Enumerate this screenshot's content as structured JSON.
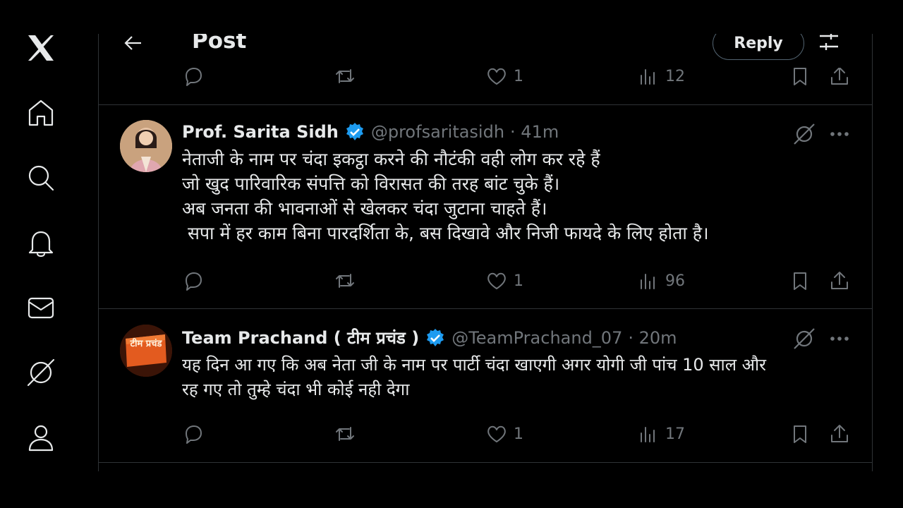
{
  "page": {
    "title": "Post",
    "reply_button": "Reply"
  },
  "sidebar": {
    "items": [
      {
        "name": "x-logo-icon"
      },
      {
        "name": "home-icon"
      },
      {
        "name": "search-icon"
      },
      {
        "name": "bell-icon"
      },
      {
        "name": "mail-icon"
      },
      {
        "name": "grok-icon"
      },
      {
        "name": "profile-icon"
      }
    ]
  },
  "top_post": {
    "likes": "1",
    "views": "12"
  },
  "tweets": [
    {
      "name": "Prof. Sarita Sidh",
      "handle": "@profsaritasidh",
      "time": "· 41m",
      "lines": [
        "नेताजी के नाम पर चंदा इकट्ठा करने की नौटंकी वही लोग कर रहे हैं",
        "जो खुद पारिवारिक संपत्ति को विरासत की तरह बांट चुके हैं।",
        "अब जनता की भावनाओं से खेलकर चंदा जुटाना चाहते हैं।",
        " सपा में हर काम बिना पारदर्शिता के, बस दिखावे और निजी फायदे के लिए होता है।"
      ],
      "likes": "1",
      "views": "96"
    },
    {
      "name": "Team Prachand ( टीम प्रचंड )",
      "handle": "@TeamPrachand_07",
      "time": "· 20m",
      "avatar_text": "टीम प्रचंड",
      "lines": [
        "यह दिन आ गए कि अब नेता जी के नाम पर पार्टी चंदा खाएगी अगर योगी जी पांच 10 साल और",
        "रह गए तो तुम्हे चंदा भी कोई नही देगा"
      ],
      "likes": "1",
      "views": "17"
    }
  ],
  "colors": {
    "background": "#000000",
    "text": "#e7e9ea",
    "muted": "#71767b",
    "verified": "#1d9bf0",
    "border": "#2f3336"
  }
}
